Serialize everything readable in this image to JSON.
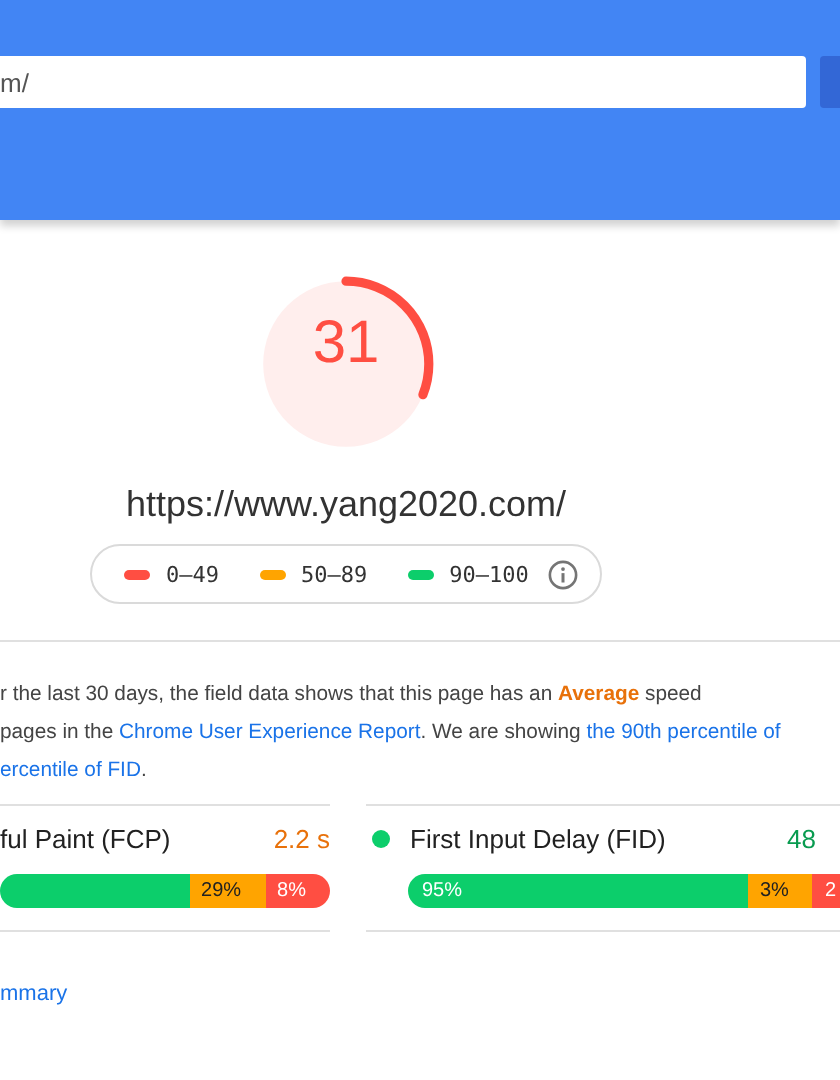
{
  "url_field": {
    "value": "m/"
  },
  "gauge": {
    "score": "31",
    "level": 0.31
  },
  "tested_url": "https://www.yang2020.com/",
  "legend": [
    {
      "label": "0–49",
      "color": "#ff4e42"
    },
    {
      "label": "50–89",
      "color": "#ffa400"
    },
    {
      "label": "90–100",
      "color": "#0cce6b"
    }
  ],
  "field_data": {
    "lines": [
      [
        {
          "kind": "plain",
          "text": "r the last 30 days, the field data shows that this page has an "
        },
        {
          "kind": "highlight",
          "text": "Average"
        },
        {
          "kind": "plain",
          "text": " speed"
        }
      ],
      [
        {
          "kind": "plain",
          "text": "pages in the "
        },
        {
          "kind": "link",
          "text": "Chrome User Experience Report"
        },
        {
          "kind": "plain",
          "text": ". We are showing "
        },
        {
          "kind": "link",
          "text": "the 90th percentile of"
        }
      ],
      [
        {
          "kind": "link",
          "text": "ercentile of FID"
        },
        {
          "kind": "plain",
          "text": "."
        }
      ]
    ]
  },
  "metrics": [
    {
      "name": "ful Paint (FCP)",
      "value": "2.2 s",
      "color": "#e8710a",
      "segments": [
        {
          "color": "#0cce6b"
        },
        {
          "label": "29%",
          "color": "#ffa400"
        },
        {
          "label": "8%",
          "color": "#ff4e42"
        }
      ]
    },
    {
      "name": "First Input Delay (FID)",
      "value": "48",
      "color": "#0cce6b",
      "segments": [
        {
          "label": "95%",
          "color": "#0cce6b"
        },
        {
          "label": "3%",
          "color": "#ffa400"
        },
        {
          "label": "2",
          "color": "#ff4e42"
        }
      ]
    }
  ],
  "summary_link": "mmary"
}
